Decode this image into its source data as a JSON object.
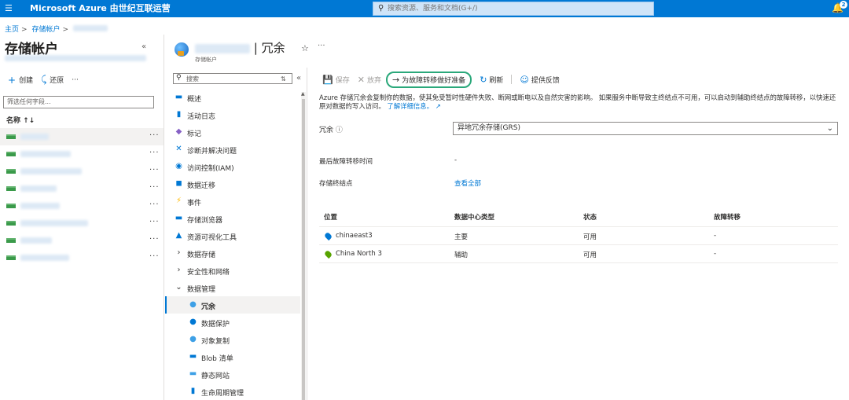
{
  "topbar": {
    "menu_icon": "hamburger-icon",
    "brand": "Microsoft Azure 由世纪互联运营",
    "search_placeholder": "搜索资源、服务和文档(G+/)",
    "notification_count": "2"
  },
  "breadcrumb": {
    "home": "主页",
    "storage_accounts": "存储帐户"
  },
  "left_pane": {
    "title": "存储帐户",
    "create_label": "创建",
    "restore_label": "还原",
    "filter_placeholder": "筛选任何字段...",
    "name_header": "名称 ↑↓",
    "items_count": 8
  },
  "resource": {
    "title_suffix": "| 冗余",
    "subtitle": "存储帐户"
  },
  "menu": {
    "search_placeholder": "搜索",
    "items": [
      {
        "label": "概述",
        "icon": "overview-icon",
        "indent": false
      },
      {
        "label": "活动日志",
        "icon": "activity-log-icon",
        "indent": false
      },
      {
        "label": "标记",
        "icon": "tag-icon",
        "indent": false
      },
      {
        "label": "诊断并解决问题",
        "icon": "diagnose-icon",
        "indent": false
      },
      {
        "label": "访问控制(IAM)",
        "icon": "iam-icon",
        "indent": false
      },
      {
        "label": "数据迁移",
        "icon": "data-migration-icon",
        "indent": false
      },
      {
        "label": "事件",
        "icon": "events-icon",
        "indent": false
      },
      {
        "label": "存储浏览器",
        "icon": "storage-browser-icon",
        "indent": false
      },
      {
        "label": "资源可视化工具",
        "icon": "resource-visualizer-icon",
        "indent": false
      },
      {
        "label": "数据存储",
        "icon": "chevron-right-icon",
        "indent": false
      },
      {
        "label": "安全性和网络",
        "icon": "chevron-right-icon",
        "indent": false
      },
      {
        "label": "数据管理",
        "icon": "chevron-down-icon",
        "indent": false
      },
      {
        "label": "冗余",
        "icon": "redundancy-icon",
        "indent": true
      },
      {
        "label": "数据保护",
        "icon": "data-protection-icon",
        "indent": true
      },
      {
        "label": "对象复制",
        "icon": "object-replication-icon",
        "indent": true
      },
      {
        "label": "Blob 清单",
        "icon": "blob-inventory-icon",
        "indent": true
      },
      {
        "label": "静态网站",
        "icon": "static-website-icon",
        "indent": true
      },
      {
        "label": "生命周期管理",
        "icon": "lifecycle-icon",
        "indent": true
      }
    ]
  },
  "toolbar": {
    "save": "保存",
    "discard": "放弃",
    "prepare_failover": "为故障转移做好准备",
    "refresh": "刷新",
    "feedback": "提供反馈"
  },
  "content": {
    "description": "Azure 存储冗余会复制你的数据，使其免受暂时性硬件失败、断网或断电以及自然灾害的影响。 如果服务中断导致主终结点不可用，可以启动到辅助终结点的故障转移，以快速还原对数据的写入访问。",
    "learn_more": "了解详细信息。",
    "redundancy_label": "冗余",
    "redundancy_value": "异地冗余存储(GRS)",
    "last_failover_label": "最后故障转移时间",
    "last_failover_value": "-",
    "endpoints_label": "存储终结点",
    "endpoints_link": "查看全部",
    "table": {
      "headers": [
        "位置",
        "数据中心类型",
        "状态",
        "故障转移"
      ],
      "rows": [
        {
          "location": "chinaeast3",
          "type": "主要",
          "status": "可用",
          "failover": "-",
          "pin_color": "#0078d4"
        },
        {
          "location": "China North 3",
          "type": "辅助",
          "status": "可用",
          "failover": "-",
          "pin_color": "#57a300"
        }
      ]
    }
  },
  "colors": {
    "accent": "#0078d4",
    "highlight_ring": "#2aa87a"
  }
}
